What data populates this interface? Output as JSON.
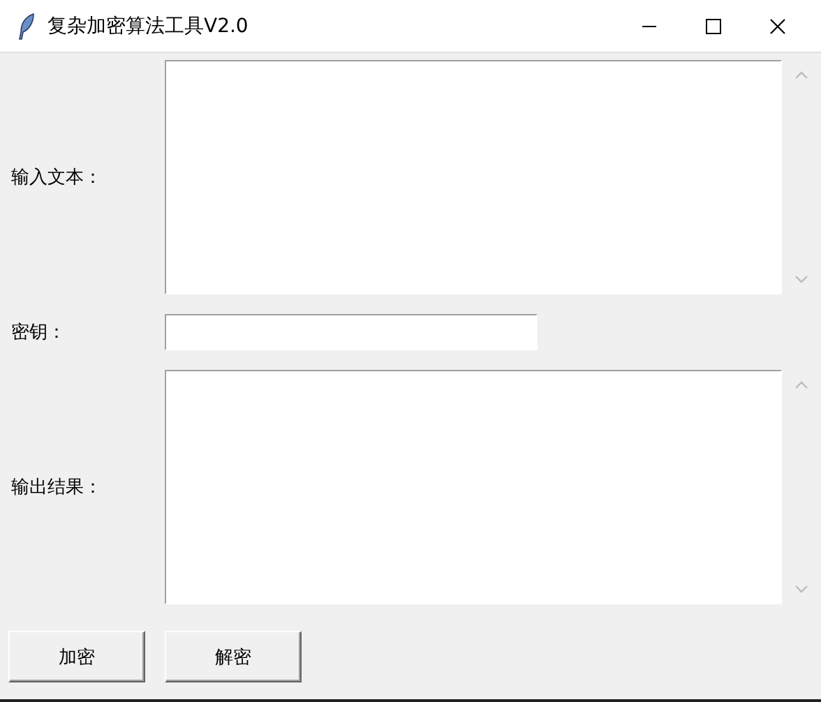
{
  "window": {
    "title": "复杂加密算法工具V2.0"
  },
  "fields": [
    {
      "kind": "textarea",
      "label": "输入文本："
    },
    {
      "kind": "entry",
      "label": "密钥："
    },
    {
      "kind": "textarea",
      "label": "输出结果："
    }
  ],
  "buttons": [
    "加密",
    "解密"
  ]
}
